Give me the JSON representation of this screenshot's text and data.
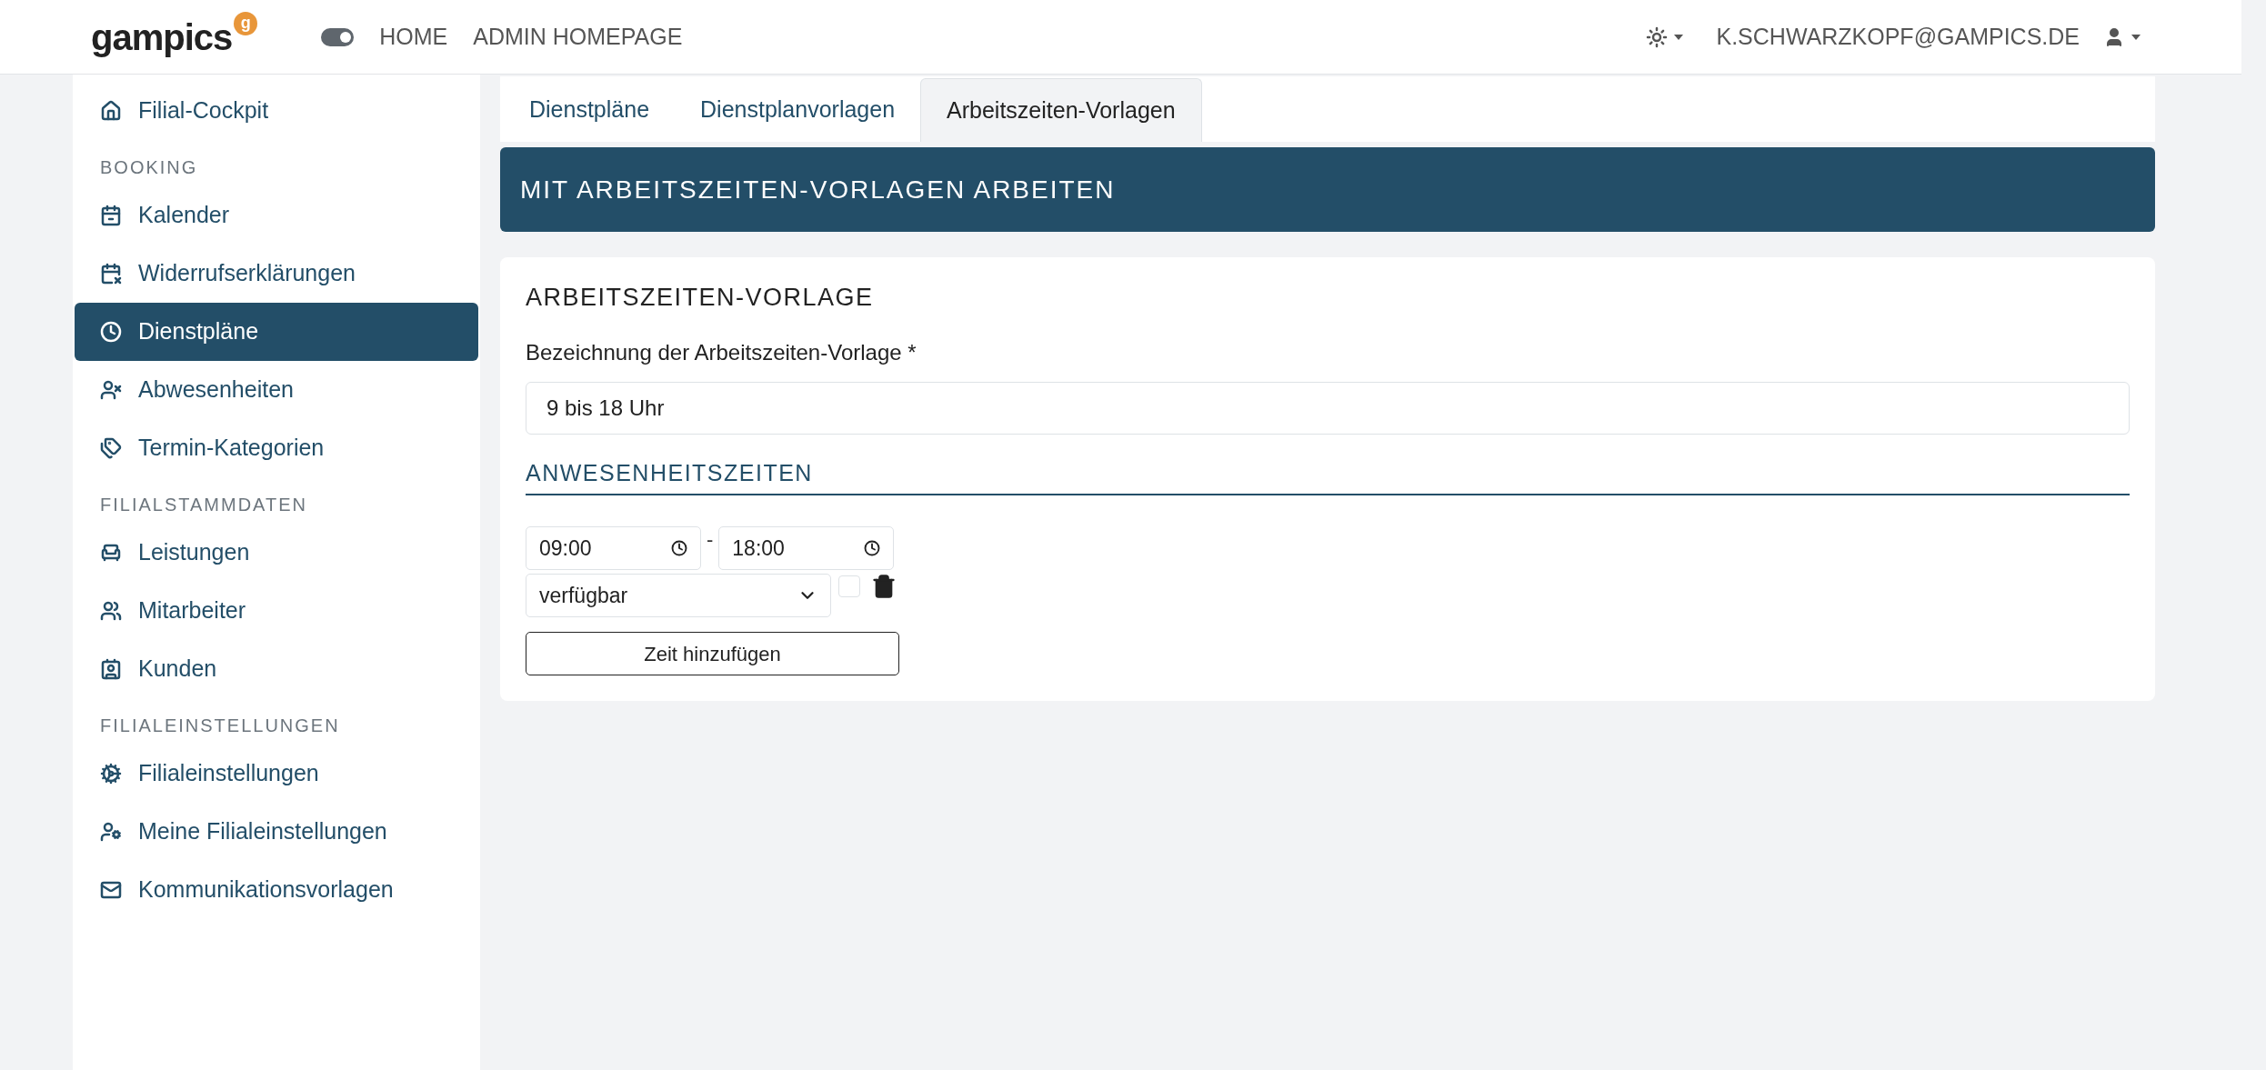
{
  "topbar": {
    "logo": "gampics",
    "logo_badge": "g",
    "theme_toggle": {
      "on": true
    },
    "nav": [
      "HOME",
      "ADMIN HOMEPAGE"
    ],
    "user": "K.SCHWARZKOPF@GAMPICS.DE"
  },
  "sidebar": {
    "items": [
      {
        "kind": "link",
        "label": "Filial-Cockpit",
        "selected": false
      },
      {
        "kind": "heading",
        "label": "BOOKING"
      },
      {
        "kind": "link",
        "label": "Kalender",
        "selected": false
      },
      {
        "kind": "link",
        "label": "Widerrufserklärungen",
        "selected": false
      },
      {
        "kind": "link",
        "label": "Dienstpläne",
        "selected": true
      },
      {
        "kind": "link",
        "label": "Abwesenheiten",
        "selected": false
      },
      {
        "kind": "link",
        "label": "Termin-Kategorien",
        "selected": false
      },
      {
        "kind": "heading",
        "label": "FILIALSTAMMDATEN"
      },
      {
        "kind": "link",
        "label": "Leistungen",
        "selected": false
      },
      {
        "kind": "link",
        "label": "Mitarbeiter",
        "selected": false
      },
      {
        "kind": "link",
        "label": "Kunden",
        "selected": false
      },
      {
        "kind": "heading",
        "label": "FILIALEINSTELLUNGEN"
      },
      {
        "kind": "link",
        "label": "Filialeinstellungen",
        "selected": false
      },
      {
        "kind": "link",
        "label": "Meine Filialeinstellungen",
        "selected": false
      },
      {
        "kind": "link",
        "label": "Kommunikationsvorlagen",
        "selected": false
      }
    ]
  },
  "tabs": [
    {
      "label": "Dienstpläne",
      "selected": false
    },
    {
      "label": "Dienstplanvorlagen",
      "selected": false
    },
    {
      "label": "Arbeitszeiten-Vorlagen",
      "selected": true
    }
  ],
  "banner": {
    "title": "MIT ARBEITSZEITEN-VORLAGEN ARBEITEN"
  },
  "card": {
    "title": "ARBEITSZEITEN-VORLAGE",
    "name_label": "Bezeichnung der Arbeitszeiten-Vorlage *",
    "name_value": "9 bis 18 Uhr",
    "section_title": "ANWESENHEITSZEITEN",
    "times": [
      {
        "from": "09:00",
        "separator": "-",
        "to": "18:00",
        "status": "verfügbar",
        "checked": false
      }
    ],
    "add_button": "Zeit hinzufügen"
  }
}
